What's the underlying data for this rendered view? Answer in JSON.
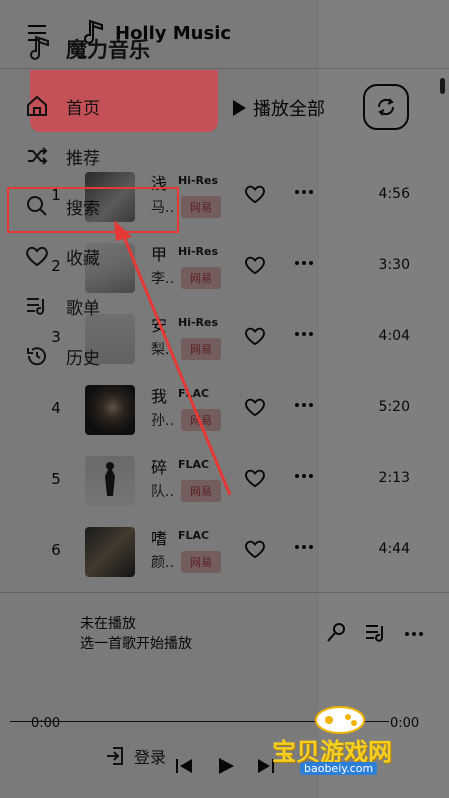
{
  "app": {
    "name": "Holly Music",
    "drawer_title": "魔力音乐"
  },
  "toolbar": {
    "play_all": "播放全部"
  },
  "drawer": {
    "items": [
      {
        "label": "首页",
        "icon": "home-icon"
      },
      {
        "label": "推荐",
        "icon": "shuffle-icon"
      },
      {
        "label": "搜索",
        "icon": "search-icon"
      },
      {
        "label": "收藏",
        "icon": "heart-icon"
      },
      {
        "label": "歌单",
        "icon": "playlist-icon"
      },
      {
        "label": "历史",
        "icon": "history-icon"
      }
    ],
    "login": "登录"
  },
  "songs": [
    {
      "index": "1",
      "title": "浅",
      "artist": "马..",
      "quality": "Hi-Res",
      "source": "网易",
      "duration": "4:56"
    },
    {
      "index": "2",
      "title": "甲",
      "artist": "李..",
      "quality": "Hi-Res",
      "source": "网易",
      "duration": "3:30"
    },
    {
      "index": "3",
      "title": "安",
      "artist": "梨..",
      "quality": "Hi-Res",
      "source": "网易",
      "duration": "4:04"
    },
    {
      "index": "4",
      "title": "我",
      "artist": "孙..",
      "quality": "FLAC",
      "source": "网易",
      "duration": "5:20"
    },
    {
      "index": "5",
      "title": "碎",
      "artist": "队..",
      "quality": "FLAC",
      "source": "网易",
      "duration": "2:13"
    },
    {
      "index": "6",
      "title": "嗜",
      "artist": "颜..",
      "quality": "FLAC",
      "source": "网易",
      "duration": "4:44"
    }
  ],
  "player": {
    "status": "未在播放",
    "hint": "选一首歌开始播放",
    "time_current": "0:00",
    "time_total": "0:00",
    "progress": 0
  },
  "watermark": {
    "text": "宝贝游戏网",
    "url": "baobeiy.com"
  },
  "colors": {
    "accent_red": "#e53935",
    "tag_bg": "#f2c2c2",
    "tag_text": "#c4444a"
  }
}
